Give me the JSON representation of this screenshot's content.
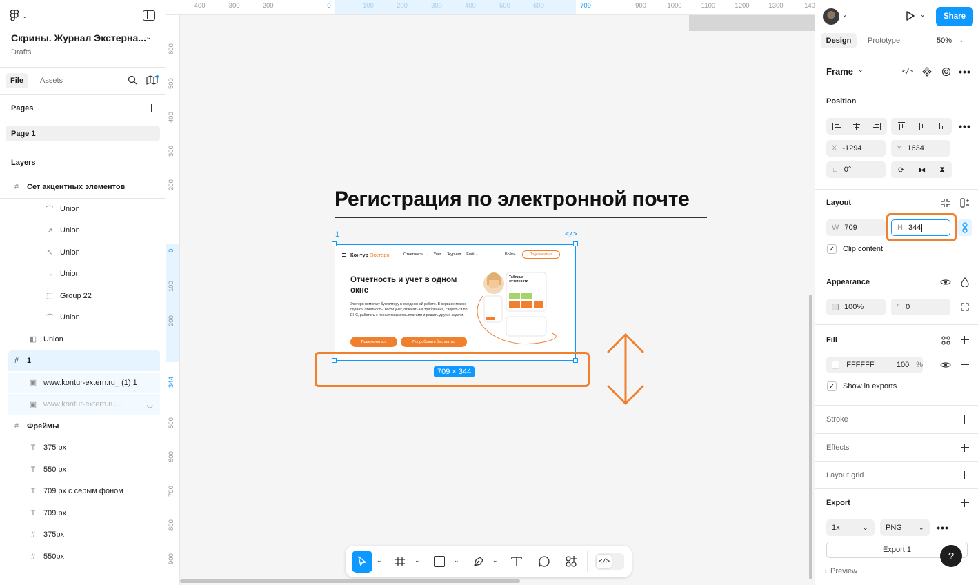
{
  "file": {
    "title": "Скрины. Журнал Экстерна...",
    "location": "Drafts"
  },
  "left_tabs": {
    "file": "File",
    "assets": "Assets"
  },
  "pages": {
    "title": "Pages",
    "items": [
      "Page 1"
    ]
  },
  "layers": {
    "title": "Layers",
    "items": [
      {
        "name": "Сет акцентных элементов",
        "icon": "frame-icon",
        "indent": 0,
        "bold": true
      },
      {
        "name": "Union",
        "icon": "curve-icon",
        "indent": 2
      },
      {
        "name": "Union",
        "icon": "arrow-up-right-icon",
        "indent": 2
      },
      {
        "name": "Union",
        "icon": "arrow-up-left-icon",
        "indent": 2
      },
      {
        "name": "Union",
        "icon": "arrow-right-icon",
        "indent": 2
      },
      {
        "name": "Group 22",
        "icon": "group-icon",
        "indent": 2
      },
      {
        "name": "Union",
        "icon": "curve-icon",
        "indent": 2
      },
      {
        "name": "Union",
        "icon": "union-icon",
        "indent": 1
      },
      {
        "name": "1",
        "icon": "frame-icon",
        "indent": 0,
        "bold": true,
        "selected": true
      },
      {
        "name": "www.kontur-extern.ru_ (1) 1",
        "icon": "image-icon",
        "indent": 1,
        "child": true
      },
      {
        "name": "www.kontur-extern.ru...",
        "icon": "image-icon",
        "indent": 1,
        "child": true,
        "hidden": true
      },
      {
        "name": "Фреймы",
        "icon": "frame-icon",
        "indent": 0,
        "bold": true
      },
      {
        "name": "375 px",
        "icon": "text-icon",
        "indent": 1
      },
      {
        "name": "550 px",
        "icon": "text-icon",
        "indent": 1
      },
      {
        "name": "709 px с серым фоном",
        "icon": "text-icon",
        "indent": 1
      },
      {
        "name": "709 px",
        "icon": "text-icon",
        "indent": 1
      },
      {
        "name": "375px",
        "icon": "frame-icon",
        "indent": 1
      },
      {
        "name": "550px",
        "icon": "frame-icon",
        "indent": 1
      }
    ]
  },
  "ruler_top": [
    "-400",
    "-300",
    "-200",
    "0",
    "100",
    "200",
    "300",
    "400",
    "500",
    "600",
    "709",
    "900",
    "1000",
    "1100",
    "1200",
    "1300",
    "140"
  ],
  "ruler_left": [
    "600",
    "500",
    "400",
    "300",
    "200",
    "0",
    "100",
    "200",
    "344",
    "500",
    "600",
    "700",
    "800",
    "900"
  ],
  "canvas": {
    "heading": "Регистрация по электронной почте",
    "frame_label": "1",
    "frame_size": "709 × 344",
    "mock": {
      "logo": "Контур",
      "logo_accent": "Экстерн",
      "nav": [
        "Отчетность ⌄",
        "Учет",
        "Журнал",
        "Ещё ⌄"
      ],
      "login": "Войти",
      "connect": "Подключиться",
      "hero_title": "Отчетность и учет в одном окне",
      "hero_text": "Экстерн помогает бухгалтеру в ежедневной работе. В сервисе можно сдавать отчетность, вести учет, отвечать на требования, сверяться по ЕНС, работать с проактивными выплатами и решать другие задачи.",
      "btn_primary": "Подключиться",
      "btn_secondary": "Попробовать бесплатно",
      "card_title": "Таблица отчетности"
    }
  },
  "toolbar": {
    "tools": [
      "move-tool",
      "frame-tool",
      "shape-tool",
      "pen-tool",
      "text-tool",
      "comment-tool",
      "actions-tool",
      "dev-mode-toggle"
    ]
  },
  "right": {
    "share": "Share",
    "tabs": {
      "design": "Design",
      "prototype": "Prototype"
    },
    "zoom": "50%",
    "frame_menu": "Frame",
    "position": {
      "title": "Position",
      "x_label": "X",
      "x": "-1294",
      "y_label": "Y",
      "y": "1634",
      "rotation": "0°"
    },
    "layout": {
      "title": "Layout",
      "w_label": "W",
      "w": "709",
      "h_label": "H",
      "h": "344",
      "clip": "Clip content"
    },
    "appearance": {
      "title": "Appearance",
      "opacity": "100%",
      "radius": "0"
    },
    "fill": {
      "title": "Fill",
      "hex": "FFFFFF",
      "opacity": "100",
      "pct": "%",
      "show_exports": "Show in exports"
    },
    "stroke": "Stroke",
    "effects": "Effects",
    "layout_grid": "Layout grid",
    "export": {
      "title": "Export",
      "scale": "1x",
      "format": "PNG",
      "button": "Export 1",
      "preview": "Preview"
    },
    "help": "?"
  },
  "colors": {
    "accent": "#0d99ff",
    "highlight": "#f07f2e",
    "selection_bg": "#e5f4ff"
  }
}
